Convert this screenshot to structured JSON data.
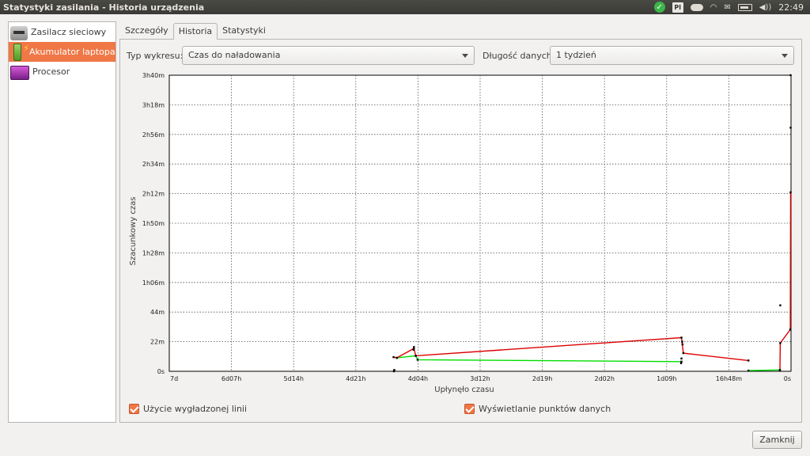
{
  "window": {
    "title": "Statystyki zasilania - Historia urządzenia"
  },
  "indicators": {
    "keyboard": "Pl",
    "volume": "◀))",
    "clock": "22:49"
  },
  "sidebar": {
    "items": [
      {
        "label": "Zasilacz sieciowy",
        "icon": "power-plug-icon"
      },
      {
        "label": "Akumulator laptopa",
        "icon": "battery-icon"
      },
      {
        "label": "Procesor",
        "icon": "cpu-icon"
      }
    ]
  },
  "tabs": [
    {
      "label": "Szczegóły"
    },
    {
      "label": "Historia"
    },
    {
      "label": "Statystyki"
    }
  ],
  "controls": {
    "graph_type_label": "Typ wykresu:",
    "graph_type_value": "Czas do naładowania",
    "data_length_label": "Długość danych:",
    "data_length_value": "1 tydzień"
  },
  "checkboxes": {
    "smoothed": "Użycie wygładzonej linii",
    "points": "Wyświetlanie punktów danych"
  },
  "close_button": "Zamknij",
  "colors": {
    "accent": "#f07746",
    "line_charging": "#00dd00",
    "line_discharging": "#dd0000"
  },
  "chart_data": {
    "type": "line",
    "xlabel": "Upłynęło czasu",
    "ylabel": "Szacunkowy czas",
    "x_ticks": [
      "7d",
      "6d07h",
      "5d14h",
      "4d21h",
      "4d04h",
      "3d12h",
      "2d19h",
      "2d02h",
      "1d09h",
      "16h48m",
      "0s"
    ],
    "y_ticks": [
      "0s",
      "22m",
      "44m",
      "1h06m",
      "1h28m",
      "1h50m",
      "2h12m",
      "2h34m",
      "2h56m",
      "3h18m",
      "3h40m"
    ],
    "x_range_hours": [
      168,
      0
    ],
    "y_range_min": [
      0,
      220
    ],
    "grid": true,
    "series": [
      {
        "color": "green",
        "points": [
          [
            106.5,
            10
          ],
          [
            101.4,
            11.5
          ],
          [
            100.9,
            8.6
          ],
          [
            29.6,
            7.2
          ]
        ]
      },
      {
        "color": "red",
        "points": [
          [
            107.4,
            10.5
          ],
          [
            106.5,
            10
          ],
          [
            101.9,
            17
          ],
          [
            101.4,
            11.5
          ],
          [
            29.6,
            25
          ],
          [
            29.1,
            13.5
          ],
          [
            11.5,
            8
          ]
        ]
      },
      {
        "color": "green",
        "points": [
          [
            11.5,
            0.5
          ],
          [
            3.0,
            1.0
          ]
        ]
      },
      {
        "color": "red",
        "points": [
          [
            3.0,
            0.5
          ],
          [
            2.9,
            21
          ],
          [
            0.2,
            31
          ],
          [
            0.1,
            133
          ]
        ]
      }
    ],
    "extra_points": [
      [
        107.2,
        1
      ],
      [
        107.3,
        0
      ],
      [
        101.9,
        18
      ],
      [
        102.0,
        16
      ],
      [
        29.7,
        6
      ],
      [
        29.6,
        9.5
      ],
      [
        29.4,
        22
      ],
      [
        29.3,
        20
      ],
      [
        2.9,
        49
      ],
      [
        0.1,
        181
      ],
      [
        0.1,
        220
      ]
    ]
  }
}
